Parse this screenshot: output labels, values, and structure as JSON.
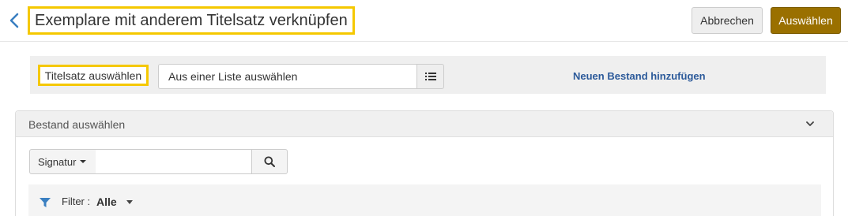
{
  "header": {
    "back_icon": "chevron-left-icon",
    "title": "Exemplare mit anderem Titelsatz verknüpfen",
    "cancel_label": "Abbrechen",
    "select_label": "Auswählen"
  },
  "record_selection": {
    "label": "Titelsatz auswählen",
    "input_value": "Aus einer Liste auswählen",
    "list_icon": "list-icon",
    "add_holding_link": "Neuen Bestand hinzufügen"
  },
  "holdings_panel": {
    "title": "Bestand auswählen",
    "chevron_icon": "chevron-down-icon",
    "search": {
      "type_label": "Signatur",
      "input_value": "",
      "search_icon": "search-icon"
    },
    "filter": {
      "icon": "filter-icon",
      "label": "Filter :",
      "value": "Alle"
    }
  },
  "colors": {
    "highlight": "#f5c800",
    "primary_button": "#9a7000",
    "link": "#2c5a9a",
    "filter_icon": "#3a7fc1",
    "back_icon": "#3a7fc1"
  }
}
